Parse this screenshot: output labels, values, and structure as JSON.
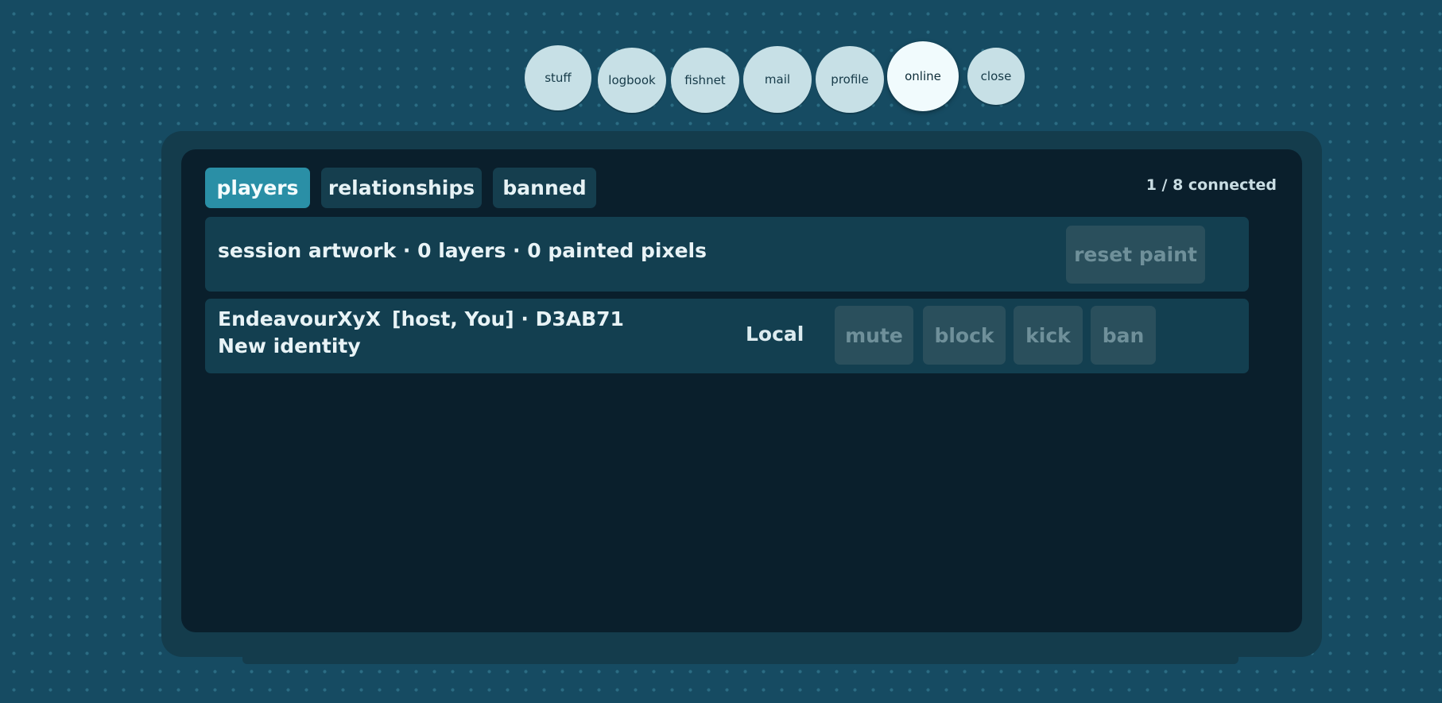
{
  "top_nav": {
    "items": [
      {
        "label": "stuff"
      },
      {
        "label": "logbook"
      },
      {
        "label": "fishnet"
      },
      {
        "label": "mail"
      },
      {
        "label": "profile"
      },
      {
        "label": "online",
        "active": true
      },
      {
        "label": "close"
      }
    ]
  },
  "tabs": [
    {
      "label": "players",
      "active": true
    },
    {
      "label": "relationships"
    },
    {
      "label": "banned"
    }
  ],
  "connected_status": "1 / 8 connected",
  "session": {
    "summary": "session artwork · 0 layers · 0 painted pixels",
    "reset_label": "reset paint"
  },
  "players": [
    {
      "name": "EndeavourXyX",
      "tags": "[host, You] · D3AB71",
      "identity": "New identity",
      "location": "Local",
      "actions": {
        "mute": "mute",
        "block": "block",
        "kick": "kick",
        "ban": "ban"
      }
    }
  ],
  "colors": {
    "background": "#164b62",
    "panel": "#143c4c",
    "panel_inner": "#0a1f2c",
    "row": "#133f50",
    "tab_active": "#2a8fa6",
    "tab": "#153e4e",
    "button_disabled": "#2a4f5c",
    "nav_bubble": "#c7e0e6",
    "nav_bubble_active": "#f1fbfd"
  }
}
